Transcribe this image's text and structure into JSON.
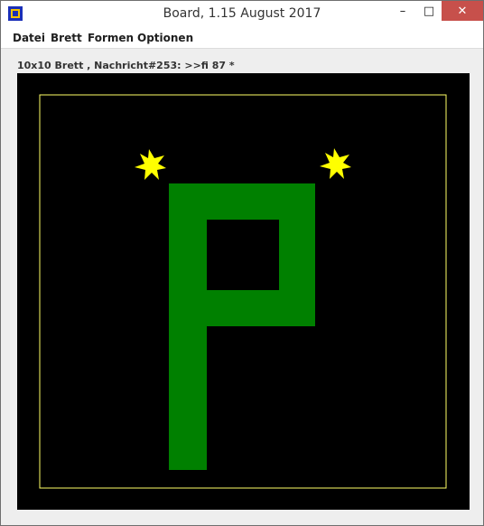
{
  "window": {
    "title": "Board, 1.15 August 2017",
    "icon": "board-app-icon",
    "controls": [
      "minimize-icon",
      "maximize-icon",
      "close-icon"
    ]
  },
  "menubar": {
    "items": [
      "Datei",
      "Brett",
      "Formen",
      "Optionen"
    ]
  },
  "status": {
    "text": "10x10 Brett , Nachricht#253: >>fi 87 *"
  },
  "board": {
    "size": "10x10",
    "background": "#000000",
    "border_color": "#ffff66",
    "shape_color": "#008000",
    "star_color": "#ffff00",
    "shape": "P",
    "stars": 2
  }
}
